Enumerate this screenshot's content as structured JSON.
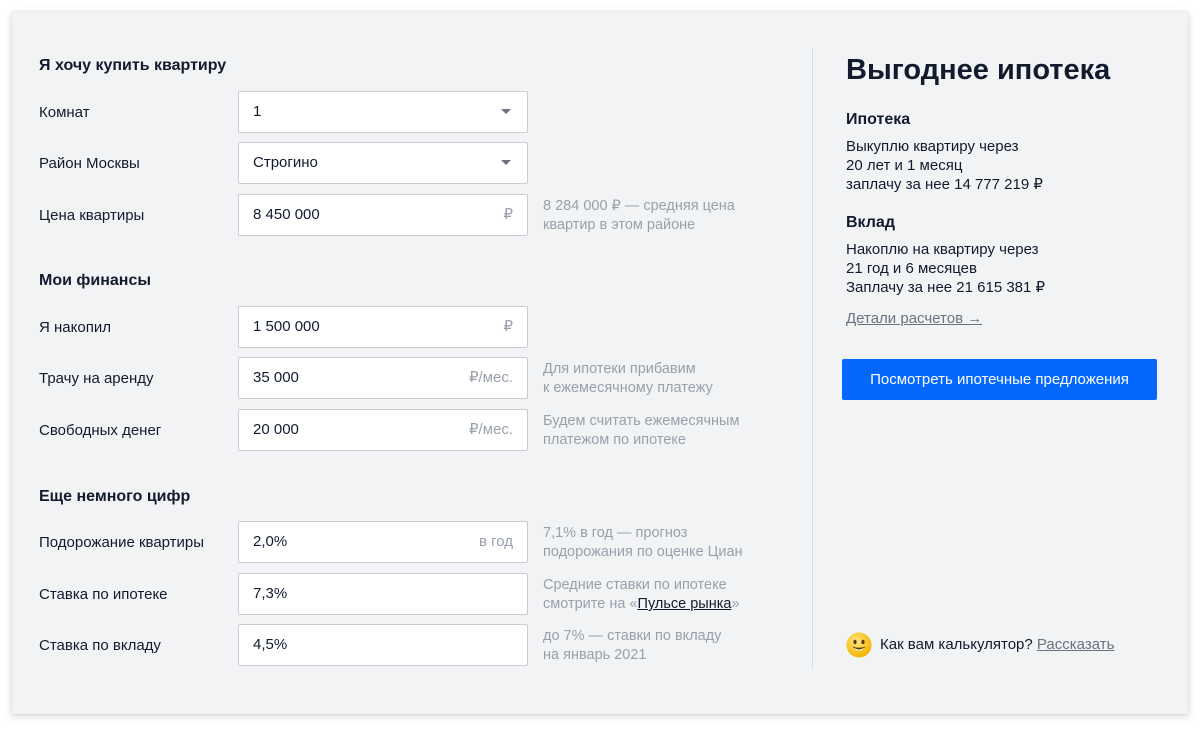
{
  "buy": {
    "title": "Я хочу купить квартиру",
    "rooms": {
      "label": "Комнат",
      "value": "1"
    },
    "district": {
      "label": "Район Москвы",
      "value": "Строгино"
    },
    "price": {
      "label": "Цена квартиры",
      "value": "8 450 000",
      "suffix": "₽",
      "hint_line1": "8 284 000 ₽ — средняя цена",
      "hint_line2": "квартир в этом районе"
    }
  },
  "finances": {
    "title": "Мои финансы",
    "saved": {
      "label": "Я накопил",
      "value": "1 500 000",
      "suffix": "₽"
    },
    "rent": {
      "label": "Трачу на аренду",
      "value": "35 000",
      "suffix": "₽/мес.",
      "hint_line1": "Для ипотеки прибавим",
      "hint_line2": "к ежемесячному платежу"
    },
    "free": {
      "label": "Свободных денег",
      "value": "20 000",
      "suffix": "₽/мес.",
      "hint_line1": "Будем считать ежемесячным",
      "hint_line2": "платежом по ипотеке"
    }
  },
  "numbers": {
    "title": "Еще немного цифр",
    "growth": {
      "label": "Подорожание квартиры",
      "value": "2,0%",
      "suffix": "в год",
      "hint_line1": "7,1% в год — прогноз",
      "hint_line2": "подорожания по оценке Циан"
    },
    "mortgage_rate": {
      "label": "Ставка по ипотеке",
      "value": "7,3%",
      "hint_line1": "Средние ставки по ипотеке",
      "hint_line2_prefix": "смотрите на «",
      "hint_link": "Пульсе рынка",
      "hint_line2_suffix": "»"
    },
    "deposit_rate": {
      "label": "Ставка по вкладу",
      "value": "4,5%",
      "hint_line1": "до 7% — ставки по вкладу",
      "hint_line2": "на январь 2021"
    }
  },
  "result": {
    "title": "Выгоднее ипотека",
    "mortgage": {
      "title": "Ипотека",
      "line1": "Выкуплю квартиру через",
      "line2": "20 лет и 1 месяц",
      "line3": "заплачу за нее 14 777 219 ₽"
    },
    "deposit": {
      "title": "Вклад",
      "line1": "Накоплю на квартиру через",
      "line2": "21 год и 6 месяцев",
      "line3": "Заплачу за нее 21 615 381 ₽"
    },
    "details_link": "Детали расчетов →",
    "cta_label": "Посмотреть ипотечные предложения"
  },
  "feedback": {
    "icon": "smile-emoji-icon",
    "question": "Как вам калькулятор? ",
    "link": "Рассказать"
  },
  "colors": {
    "accent": "#0468ff",
    "background": "#f2f3f5",
    "text": "#121a2e",
    "muted": "#9aa0ab"
  }
}
